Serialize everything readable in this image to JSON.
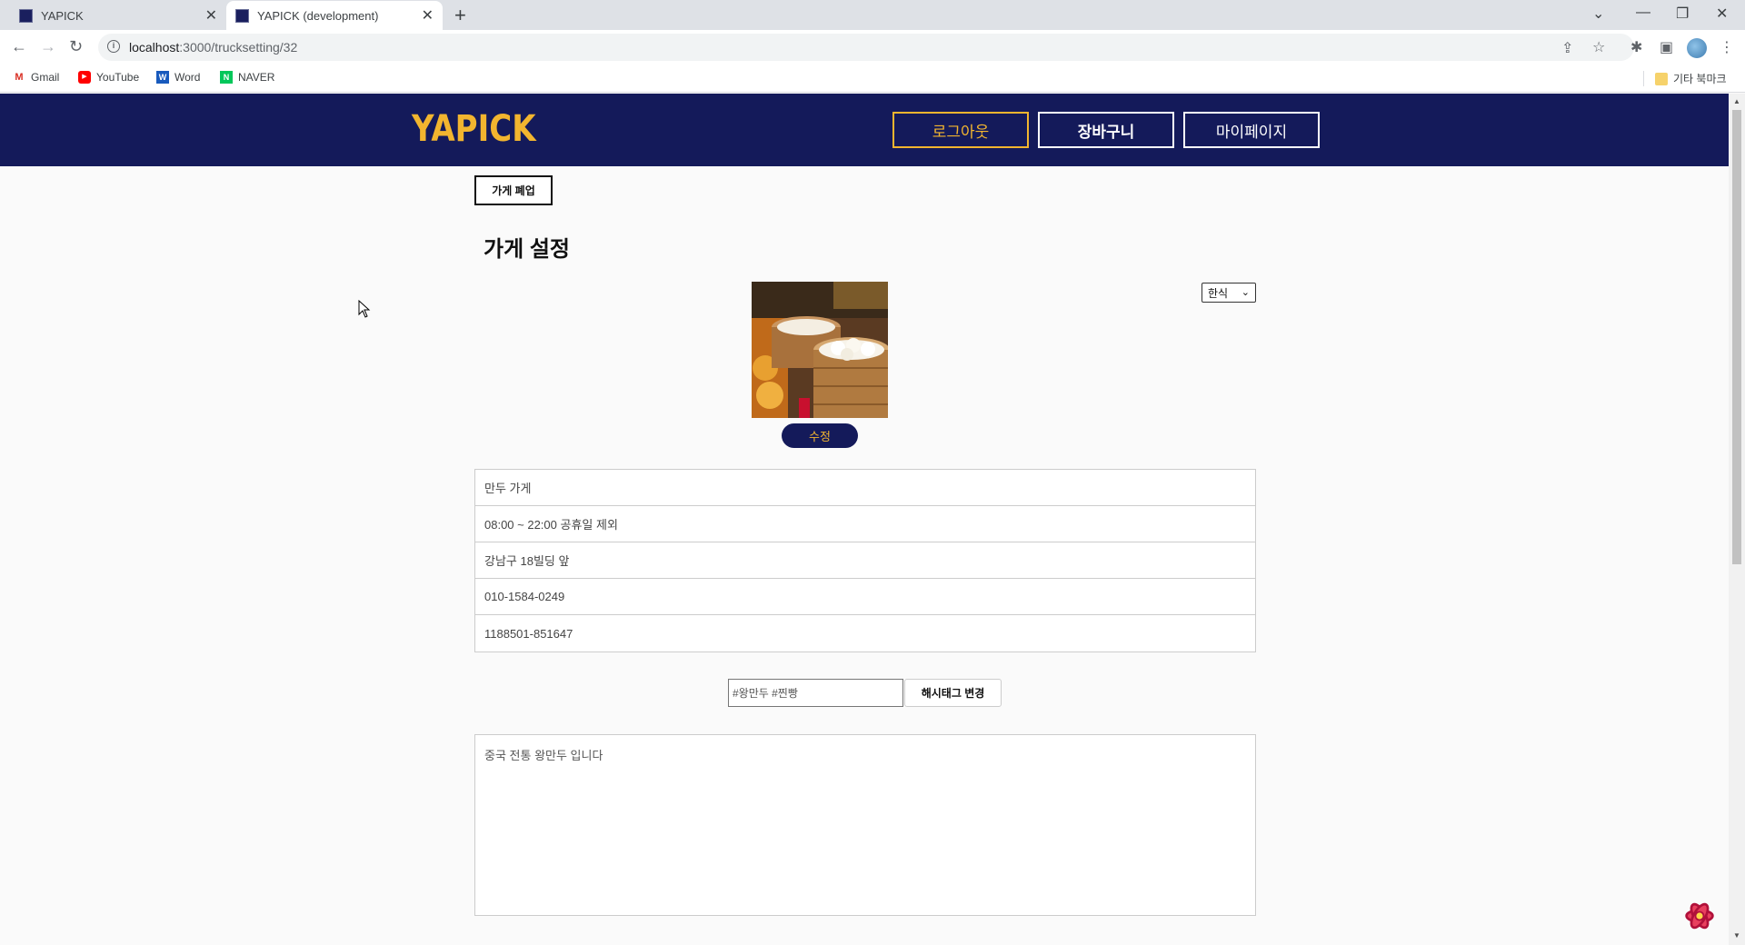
{
  "browser": {
    "tabs": [
      {
        "title": "YAPICK"
      },
      {
        "title": "YAPICK (development)"
      }
    ],
    "url_host": "localhost",
    "url_path": ":3000/trucksetting/32",
    "bookmarks": [
      "Gmail",
      "YouTube",
      "Word",
      "NAVER"
    ],
    "other_bookmarks": "기타 북마크"
  },
  "header": {
    "logo": "YAPICK",
    "logout_label": "로그아웃",
    "cart_label": "장바구니",
    "mypage_label": "마이페이지"
  },
  "page": {
    "close_store_label": "가게 폐업",
    "title": "가게 설정",
    "edit_photo_label": "수정",
    "category_selected": "한식",
    "info_rows": [
      "만두 가게",
      "08:00 ~ 22:00 공휴일 제외",
      "강남구 18빌딩 앞",
      "010-1584-0249",
      "1188501-851647"
    ],
    "hashtag_value": "#왕만두 #찐빵",
    "hashtag_button_label": "해시태그 변경",
    "description": "중국 전통 왕만두 입니다"
  }
}
